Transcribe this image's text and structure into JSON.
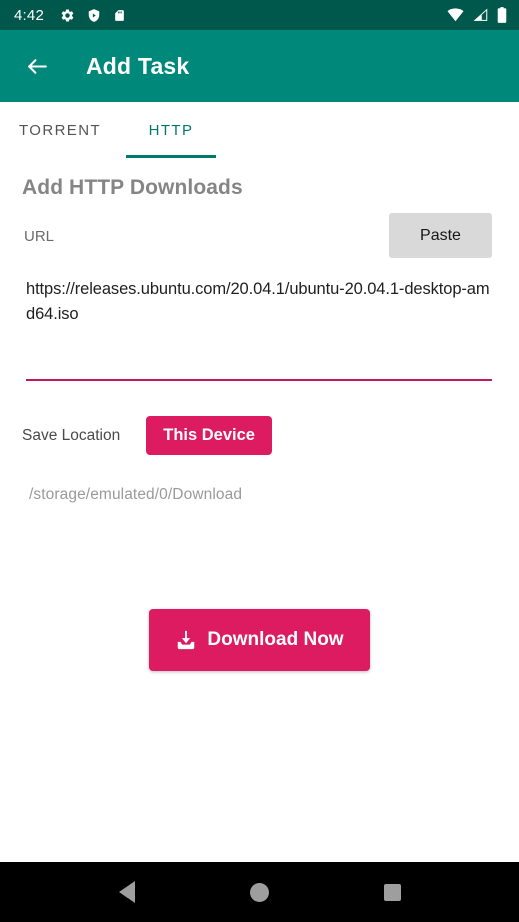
{
  "status_bar": {
    "time": "4:42",
    "left_icons": [
      "gear-icon",
      "shield-play-icon",
      "sd-card-icon"
    ],
    "right_icons": [
      "wifi-icon",
      "cellular-signal-icon",
      "battery-icon"
    ],
    "background_color": "#00574B"
  },
  "app_bar": {
    "back_icon": "arrow-left-icon",
    "title": "Add Task",
    "background_color": "#00897B"
  },
  "tabs": [
    {
      "label": "TORRENT",
      "active": false
    },
    {
      "label": "HTTP",
      "active": true
    }
  ],
  "tab_indicator_color": "#00796B",
  "main": {
    "heading": "Add HTTP Downloads",
    "url_label": "URL",
    "paste_label": "Paste",
    "url_value": "https://releases.ubuntu.com/20.04.1/ubuntu-20.04.1-desktop-amd64.iso",
    "url_placeholder": "URL",
    "url_underline_color": "#C2185B",
    "save_location_label": "Save Location",
    "save_location_value": "This Device",
    "save_path": "/storage/emulated/0/Download",
    "download_label": "Download Now",
    "download_icon": "download-icon",
    "accent_color": "#DD1B60"
  },
  "nav_bar": {
    "back": "triangle-back-icon",
    "home": "circle-home-icon",
    "recents": "square-recents-icon",
    "background_color": "#000000"
  }
}
